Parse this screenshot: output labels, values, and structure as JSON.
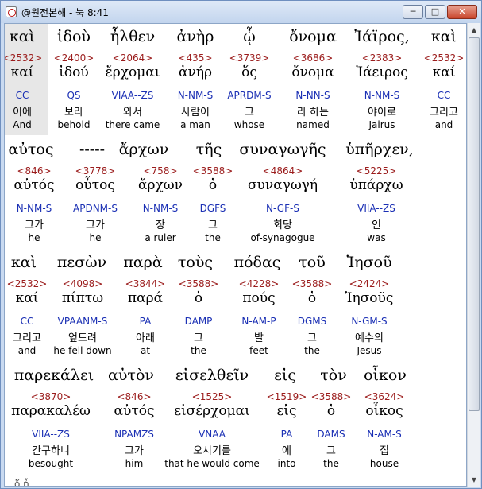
{
  "window": {
    "title": "@원전본해 - 눅 8:41",
    "minimize_label": "─",
    "maximize_label": "□",
    "close_label": "✕"
  },
  "rows": [
    {
      "greek": [
        "καὶ",
        "ἰδοὺ",
        "ἦλθεν",
        "ἀνὴρ",
        "ᾧ",
        "ὄνομα",
        "Ἰάϊρος,",
        "καὶ"
      ],
      "words": [
        {
          "strong": "<2532>",
          "lex": "καί",
          "parse": "CC",
          "kor": "이에",
          "eng": "And"
        },
        {
          "strong": "<2400>",
          "lex": "ἰδού",
          "parse": "QS",
          "kor": "보라",
          "eng": "behold"
        },
        {
          "strong": "<2064>",
          "lex": "ἔρχομαι",
          "parse": "VIAA--ZS",
          "kor": "와서",
          "eng": "there came"
        },
        {
          "strong": "<435>",
          "lex": "ἀνήρ",
          "parse": "N-NM-S",
          "kor": "사람이",
          "eng": "a man"
        },
        {
          "strong": "<3739>",
          "lex": "ὅς",
          "parse": "APRDM-S",
          "kor": "그",
          "eng": "whose"
        },
        {
          "strong": "<3686>",
          "lex": "ὄνομα",
          "parse": "N-NN-S",
          "kor": "라 하는",
          "eng": "named"
        },
        {
          "strong": "<2383>",
          "lex": "Ἰάειρος",
          "parse": "N-NM-S",
          "kor": "야이로",
          "eng": "Jairus"
        },
        {
          "strong": "<2532>",
          "lex": "καί",
          "parse": "CC",
          "kor": "그리고",
          "eng": "and"
        }
      ]
    },
    {
      "greek": [
        "αὐτος",
        "-----",
        "ἄρχων",
        "τῆς",
        "συναγωγῆς",
        "ὑπῆρχεν,"
      ],
      "words": [
        {
          "strong": "<846>",
          "lex": "αὐτός",
          "parse": "N-NM-S",
          "kor": "그가",
          "eng": "he"
        },
        {
          "strong": "<3778>",
          "lex": "οὗτος",
          "parse": "APDNM-S",
          "kor": "그가",
          "eng": "he"
        },
        {
          "strong": "<758>",
          "lex": "ἄρχων",
          "parse": "N-NM-S",
          "kor": "장",
          "eng": "a ruler"
        },
        {
          "strong": "<3588>",
          "lex": "ὁ",
          "parse": "DGFS",
          "kor": "그",
          "eng": "the"
        },
        {
          "strong": "<4864>",
          "lex": "συναγωγή",
          "parse": "N-GF-S",
          "kor": "회당",
          "eng": "of-synagogue"
        },
        {
          "strong": "<5225>",
          "lex": "ὑπάρχω",
          "parse": "VIIA--ZS",
          "kor": "인",
          "eng": "was"
        }
      ]
    },
    {
      "greek": [
        "καὶ",
        "πεσὼν",
        "παρὰ",
        "τοὺς",
        "πόδας",
        "τοῦ",
        "Ἰησοῦ"
      ],
      "words": [
        {
          "strong": "<2532>",
          "lex": "καί",
          "parse": "CC",
          "kor": "그리고",
          "eng": "and"
        },
        {
          "strong": "<4098>",
          "lex": "πίπτω",
          "parse": "VPAANM-S",
          "kor": "엎드려",
          "eng": "he fell down"
        },
        {
          "strong": "<3844>",
          "lex": "παρά",
          "parse": "PA",
          "kor": "아래",
          "eng": "at"
        },
        {
          "strong": "<3588>",
          "lex": "ὁ",
          "parse": "DAMP",
          "kor": "그",
          "eng": "the"
        },
        {
          "strong": "<4228>",
          "lex": "πούς",
          "parse": "N-AM-P",
          "kor": "발",
          "eng": "feet"
        },
        {
          "strong": "<3588>",
          "lex": "ὁ",
          "parse": "DGMS",
          "kor": "그",
          "eng": "the"
        },
        {
          "strong": "<2424>",
          "lex": "Ἰησοῦς",
          "parse": "N-GM-S",
          "kor": "예수의",
          "eng": "Jesus"
        }
      ]
    },
    {
      "greek": [
        "παρεκάλει",
        "αὐτὸν",
        "εἰσελθεῖν",
        "εἰς",
        "τὸν",
        "οἶκον"
      ],
      "words": [
        {
          "strong": "<3870>",
          "lex": "παρακαλέω",
          "parse": "VIIA--ZS",
          "kor": "간구하니",
          "eng": "besought"
        },
        {
          "strong": "<846>",
          "lex": "αὐτός",
          "parse": "NPAMZS",
          "kor": "그가",
          "eng": "him"
        },
        {
          "strong": "<1525>",
          "lex": "εἰσέρχομαι",
          "parse": "VNAA",
          "kor": "오시기를",
          "eng": "that he would come"
        },
        {
          "strong": "<1519>",
          "lex": "εἰς",
          "parse": "PA",
          "kor": "에",
          "eng": "into"
        },
        {
          "strong": "<3588>",
          "lex": "ὁ",
          "parse": "DAMS",
          "kor": "그",
          "eng": "the"
        },
        {
          "strong": "<3624>",
          "lex": "οἶκος",
          "parse": "N-AM-S",
          "kor": "집",
          "eng": "house"
        }
      ]
    }
  ],
  "overflow_hint": "ὅ  ἦ"
}
